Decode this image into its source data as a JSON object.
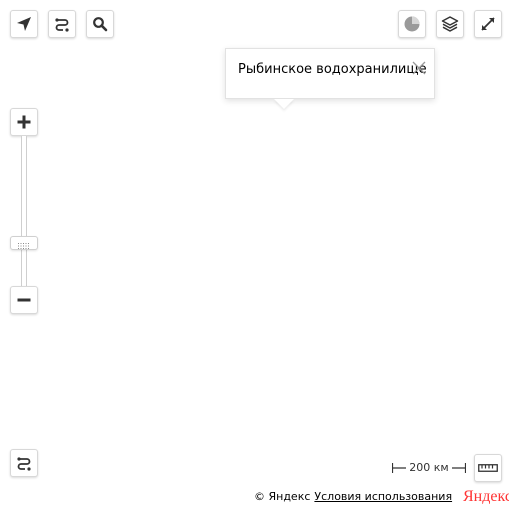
{
  "balloon": {
    "title": "Рыбинское водохранилище"
  },
  "scale": {
    "label": "200 км"
  },
  "copyright": {
    "text": "© Яндекс",
    "terms_link": "Условия использования",
    "logo": "Яндекс"
  },
  "colors": {
    "logo_red": "#f33",
    "icon_dark": "#333333"
  },
  "controls": {
    "geolocation": "geolocation-arrow-icon",
    "route": "route-icon",
    "search": "search-icon",
    "traffic": "traffic-icon",
    "layers": "layers-icon",
    "fullscreen": "fullscreen-icon",
    "zoom_in": "plus-icon",
    "zoom_out": "minus-icon",
    "ruler": "ruler-icon",
    "route_panel": "route-icon"
  }
}
